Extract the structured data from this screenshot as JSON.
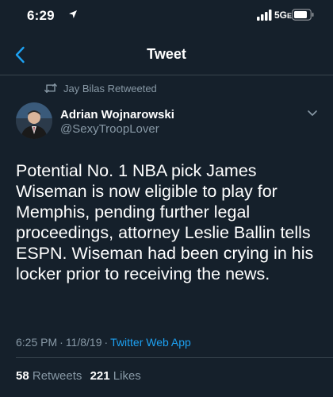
{
  "status_bar": {
    "time": "6:29",
    "network": "5G",
    "network_suffix": "E"
  },
  "nav": {
    "title": "Tweet",
    "back_icon": "chevron-left-icon"
  },
  "retweet_context": {
    "icon": "retweet-icon",
    "text": "Jay Bilas Retweeted"
  },
  "author": {
    "name": "Adrian Wojnarowski",
    "handle": "@SexyTroopLover"
  },
  "tweet": {
    "text": "Potential No. 1 NBA pick James Wiseman is now eligible to play for Memphis, pending further legal proceedings, attorney Leslie Ballin tells ESPN. Wiseman had been crying in his locker prior to receiving the news.",
    "time": "6:25 PM",
    "date": "11/8/19",
    "source": "Twitter Web App"
  },
  "stats": {
    "retweets_count": "58",
    "retweets_label": "Retweets",
    "likes_count": "221",
    "likes_label": "Likes"
  },
  "colors": {
    "background": "#15202b",
    "secondary_text": "#8899a6",
    "accent": "#1da1f2",
    "divider": "#38444d"
  }
}
